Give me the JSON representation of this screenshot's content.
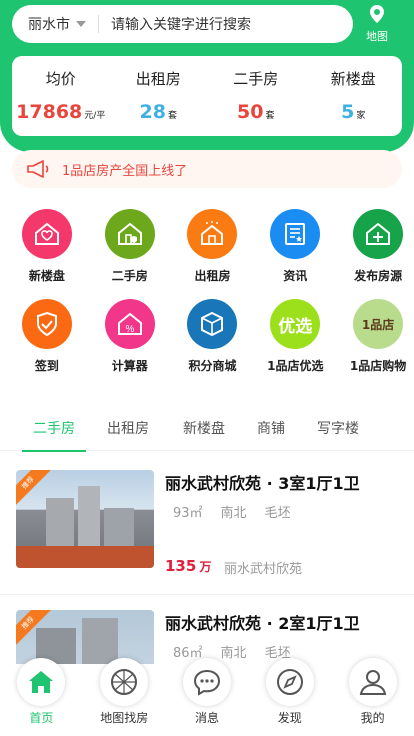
{
  "search": {
    "city": "丽水市",
    "placeholder": "请输入关键字进行搜索"
  },
  "map_button": {
    "label": "地图"
  },
  "stats": [
    {
      "title": "均价",
      "value": "17868",
      "unit": "元/平",
      "color": "#e8453c"
    },
    {
      "title": "出租房",
      "value": "28",
      "unit": "套",
      "color": "#3fb0e4"
    },
    {
      "title": "二手房",
      "value": "50",
      "unit": "套",
      "color": "#e8453c"
    },
    {
      "title": "新楼盘",
      "value": "5",
      "unit": "家",
      "color": "#3fb0e4"
    }
  ],
  "notice": {
    "text": "1品店房产全国上线了"
  },
  "menu": [
    {
      "label": "新楼盘",
      "icon": "new-building-icon",
      "color": "#f5386b"
    },
    {
      "label": "二手房",
      "icon": "secondhand-house-icon",
      "color": "#6da81c"
    },
    {
      "label": "出租房",
      "icon": "rental-house-icon",
      "color": "#fb7b13"
    },
    {
      "label": "资讯",
      "icon": "news-icon",
      "color": "#1b8cf1"
    },
    {
      "label": "发布房源",
      "icon": "publish-listing-icon",
      "color": "#16a34a"
    },
    {
      "label": "签到",
      "icon": "checkin-icon",
      "color": "#fb6a13"
    },
    {
      "label": "计算器",
      "icon": "calculator-icon",
      "color": "#f2378a"
    },
    {
      "label": "积分商城",
      "icon": "points-mall-icon",
      "color": "#1976b9"
    },
    {
      "label": "1品店优选",
      "icon": "preferred-icon",
      "color": "#9be01a",
      "text": "优选"
    },
    {
      "label": "1品店购物",
      "icon": "shopping-logo-icon",
      "color": "#b9dc8c",
      "text": "1品店"
    }
  ],
  "tabs": [
    "二手房",
    "出租房",
    "新楼盘",
    "商铺",
    "写字楼"
  ],
  "listings": [
    {
      "badge": "推荐",
      "title": "丽水武村欣苑 · 3室1厅1卫",
      "area": "93㎡",
      "orientation": "南北",
      "decoration": "毛坯",
      "price": "135",
      "price_unit": "万",
      "community": "丽水武村欣苑"
    },
    {
      "badge": "推荐",
      "title": "丽水武村欣苑 · 2室1厅1卫",
      "area": "86㎡",
      "orientation": "南北",
      "decoration": "毛坯"
    }
  ],
  "nav": [
    {
      "label": "首页",
      "icon": "home-icon"
    },
    {
      "label": "地图找房",
      "icon": "map-search-icon"
    },
    {
      "label": "消息",
      "icon": "message-icon"
    },
    {
      "label": "发现",
      "icon": "discover-icon"
    },
    {
      "label": "我的",
      "icon": "profile-icon"
    }
  ],
  "colors": {
    "brand": "#1ec46f",
    "price": "#e01f3d"
  }
}
